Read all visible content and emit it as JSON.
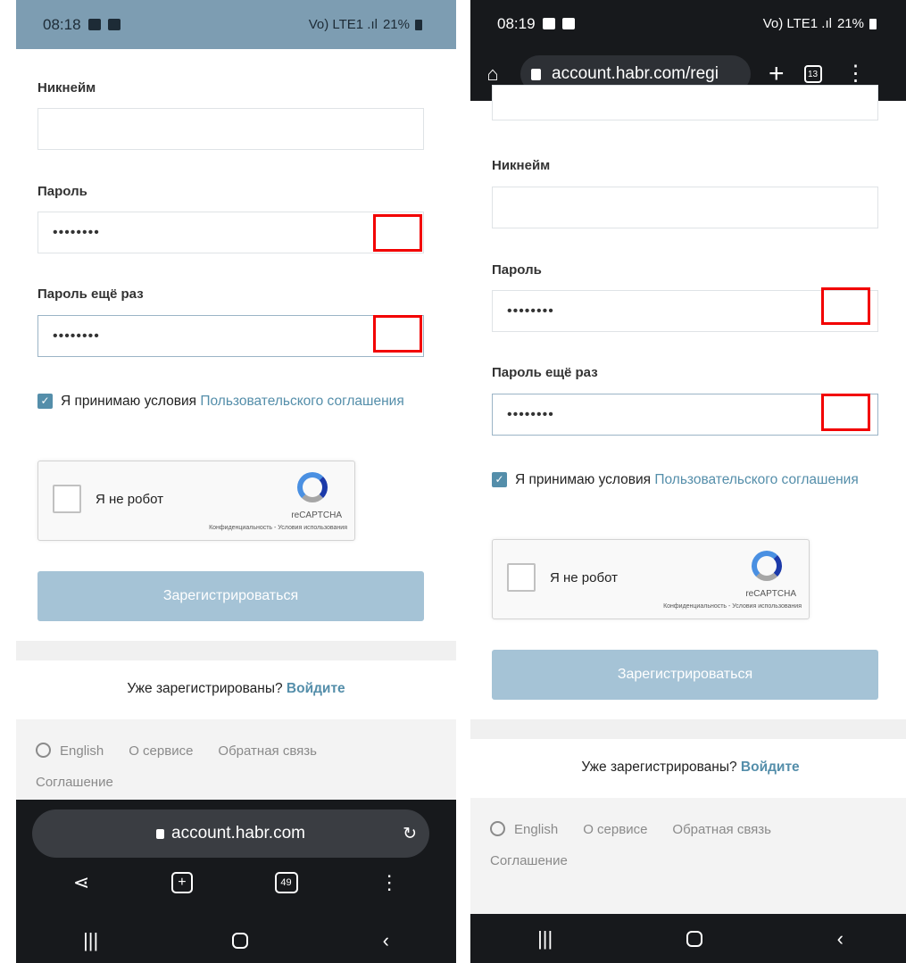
{
  "left": {
    "status": {
      "time": "08:18",
      "battery": "21%",
      "signal": "Vo) LTE1 .ıl"
    },
    "form": {
      "nickname_label": "Никнейм",
      "nickname_value": "",
      "password_label": "Пароль",
      "password_value": "••••••••",
      "password_repeat_label": "Пароль ещё раз",
      "password_repeat_value": "••••••••",
      "agree_text": "Я принимаю условия",
      "agree_link": "Пользовательского соглашения",
      "captcha_text": "Я не робот",
      "captcha_brand": "reCAPTCHA",
      "captcha_terms": "Конфиденциальность - Условия использования",
      "submit_label": "Зарегистрироваться"
    },
    "login": {
      "text": "Уже зарегистрированы?",
      "link": "Войдите"
    },
    "footer": {
      "english": "English",
      "about": "О сервисе",
      "feedback": "Обратная связь",
      "agreement": "Соглашение"
    },
    "browser": {
      "url": "account.habr.com",
      "tabs_count": "49"
    }
  },
  "right": {
    "status": {
      "time": "08:19",
      "battery": "21%",
      "signal": "Vo) LTE1 .ıl"
    },
    "browser": {
      "url": "account.habr.com/regi",
      "tabs_count": "13"
    },
    "form": {
      "nickname_label": "Никнейм",
      "nickname_value": "",
      "password_label": "Пароль",
      "password_value": "••••••••",
      "password_repeat_label": "Пароль ещё раз",
      "password_repeat_value": "••••••••",
      "agree_text": "Я принимаю условия",
      "agree_link": "Пользовательского соглашения",
      "captcha_text": "Я не робот",
      "captcha_brand": "reCAPTCHA",
      "captcha_terms": "Конфиденциальность - Условия использования",
      "submit_label": "Зарегистрироваться"
    },
    "login": {
      "text": "Уже зарегистрированы?",
      "link": "Войдите"
    },
    "footer": {
      "english": "English",
      "about": "О сервисе",
      "feedback": "Обратная связь",
      "agreement": "Соглашение"
    }
  },
  "colors": {
    "link": "#548eaa",
    "submit_disabled": "#a5c3d6",
    "highlight": "#f20000",
    "browser_dark": "#17191c"
  }
}
